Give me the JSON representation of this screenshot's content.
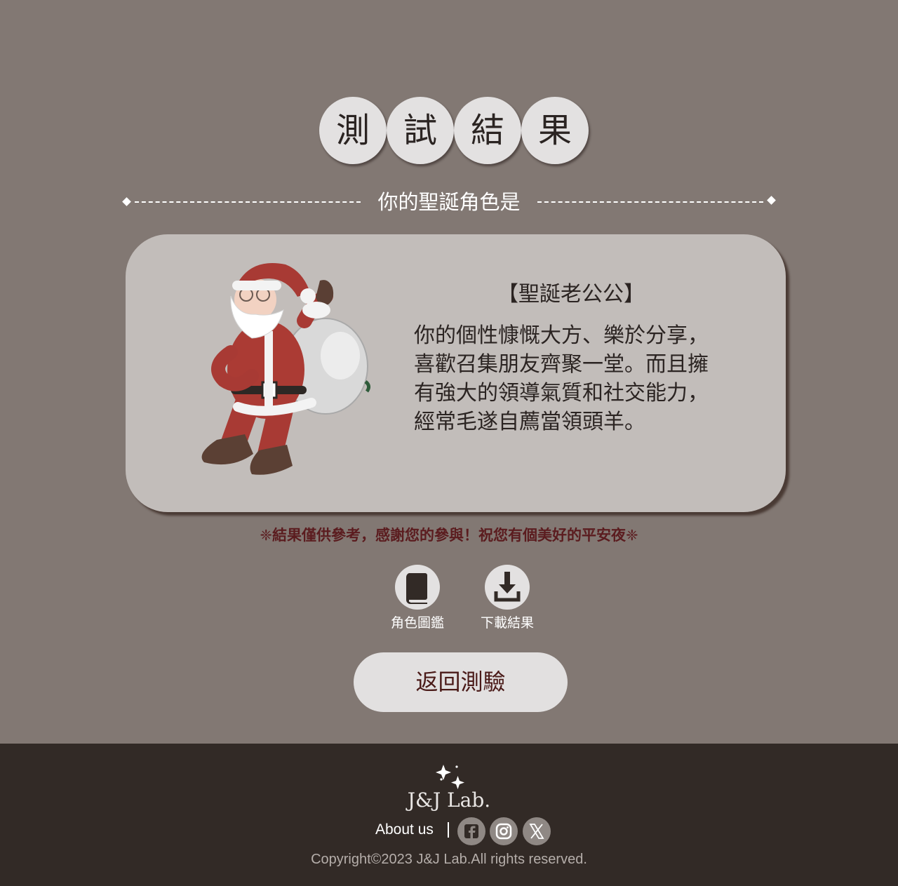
{
  "title_chars": [
    "測",
    "試",
    "結",
    "果"
  ],
  "subtitle": "你的聖誕角色是",
  "result": {
    "name": "【聖誕老公公】",
    "description": "你的個性慷慨大方、樂於分享，喜歡召集朋友齊聚一堂。而且擁有強大的領導氣質和社交能力，經常毛遂自薦當領頭羊。"
  },
  "note": "❈結果僅供參考，感謝您的參與！祝您有個美好的平安夜❈",
  "actions": {
    "gallery_label": "角色圖鑑",
    "download_label": "下載結果"
  },
  "back_button": "返回測驗",
  "footer": {
    "logo_text": "J&J Lab.",
    "about": "About us",
    "social_icons": [
      "facebook-icon",
      "instagram-icon",
      "x-icon"
    ],
    "copyright": "Copyright©2023 J&J Lab.All rights reserved."
  },
  "colors": {
    "background": "#827873",
    "card": "#c2bdba",
    "footer": "#322a26",
    "note": "#5b1c1f"
  }
}
